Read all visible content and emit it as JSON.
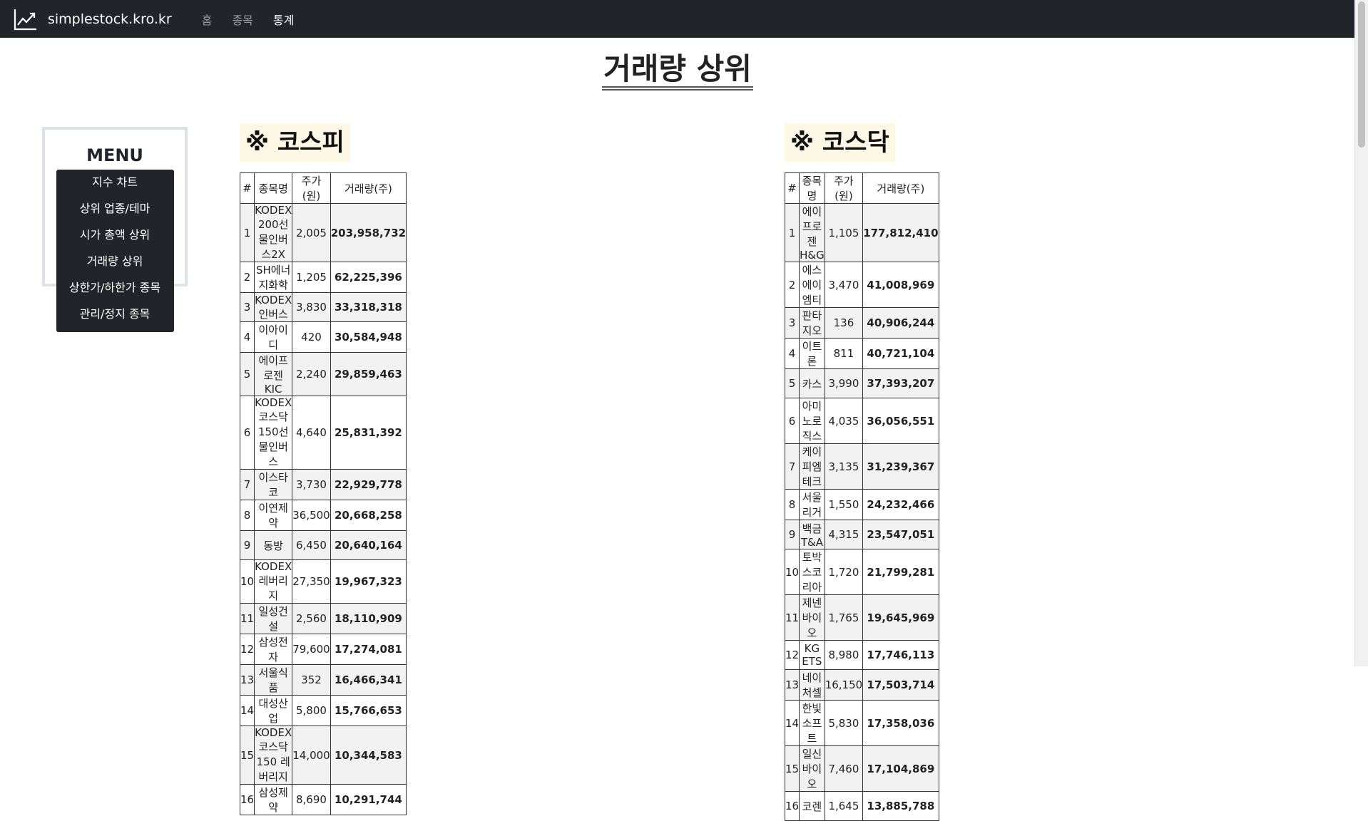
{
  "navbar": {
    "brand": "simplestock.kro.kr",
    "links": [
      "홈",
      "종목",
      "통계"
    ],
    "active_index": 2
  },
  "page_title": "거래량 상위",
  "menu": {
    "title": "MENU",
    "items": [
      "지수 차트",
      "상위 업종/테마",
      "시가 총액 상위",
      "거래량 상위",
      "상한가/하한가 종목",
      "관리/정지 종목"
    ]
  },
  "kospi": {
    "title": "※ 코스피",
    "headers": [
      "#",
      "종목명",
      "주가(원)",
      "거래량(주)"
    ],
    "rows": [
      [
        "1",
        "KODEX 200선물인버스2X",
        "2,005",
        "203,958,732"
      ],
      [
        "2",
        "SH에너지화학",
        "1,205",
        "62,225,396"
      ],
      [
        "3",
        "KODEX 인버스",
        "3,830",
        "33,318,318"
      ],
      [
        "4",
        "이아이디",
        "420",
        "30,584,948"
      ],
      [
        "5",
        "에이프로젠 KIC",
        "2,240",
        "29,859,463"
      ],
      [
        "6",
        "KODEX 코스닥150선물인버스",
        "4,640",
        "25,831,392"
      ],
      [
        "7",
        "이스타코",
        "3,730",
        "22,929,778"
      ],
      [
        "8",
        "이연제약",
        "36,500",
        "20,668,258"
      ],
      [
        "9",
        "동방",
        "6,450",
        "20,640,164"
      ],
      [
        "10",
        "KODEX 레버리지",
        "27,350",
        "19,967,323"
      ],
      [
        "11",
        "일성건설",
        "2,560",
        "18,110,909"
      ],
      [
        "12",
        "삼성전자",
        "79,600",
        "17,274,081"
      ],
      [
        "13",
        "서울식품",
        "352",
        "16,466,341"
      ],
      [
        "14",
        "대성산업",
        "5,800",
        "15,766,653"
      ],
      [
        "15",
        "KODEX 코스닥150 레버리지",
        "14,000",
        "10,344,583"
      ],
      [
        "16",
        "삼성제약",
        "8,690",
        "10,291,744"
      ]
    ]
  },
  "kosdaq": {
    "title": "※ 코스닥",
    "headers": [
      "#",
      "종목명",
      "주가(원)",
      "거래량(주)"
    ],
    "rows": [
      [
        "1",
        "에이프로젠 H&G",
        "1,105",
        "177,812,410"
      ],
      [
        "2",
        "에스에이엠티",
        "3,470",
        "41,008,969"
      ],
      [
        "3",
        "판타지오",
        "136",
        "40,906,244"
      ],
      [
        "4",
        "이트론",
        "811",
        "40,721,104"
      ],
      [
        "5",
        "카스",
        "3,990",
        "37,393,207"
      ],
      [
        "6",
        "아미노로직스",
        "4,035",
        "36,056,551"
      ],
      [
        "7",
        "케이피엠테크",
        "3,135",
        "31,239,367"
      ],
      [
        "8",
        "서울리거",
        "1,550",
        "24,232,466"
      ],
      [
        "9",
        "백금T&A",
        "4,315",
        "23,547,051"
      ],
      [
        "10",
        "토박스코리아",
        "1,720",
        "21,799,281"
      ],
      [
        "11",
        "제넨바이오",
        "1,765",
        "19,645,969"
      ],
      [
        "12",
        "KG ETS",
        "8,980",
        "17,746,113"
      ],
      [
        "13",
        "네이처셀",
        "16,150",
        "17,503,714"
      ],
      [
        "14",
        "한빛소프트",
        "5,830",
        "17,358,036"
      ],
      [
        "15",
        "일신바이오",
        "7,460",
        "17,104,869"
      ],
      [
        "16",
        "코렌",
        "1,645",
        "13,885,788"
      ]
    ]
  },
  "icons": {
    "brand": "trending-up-icon"
  }
}
